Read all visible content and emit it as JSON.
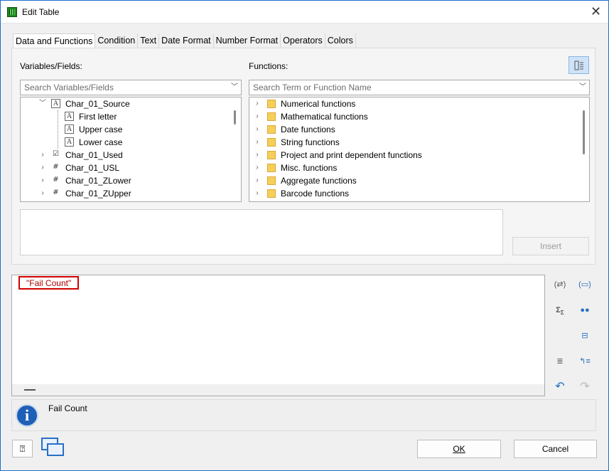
{
  "window": {
    "title": "Edit Table",
    "close_icon": "close-icon",
    "app_icon": "table-app-icon"
  },
  "tabs": [
    "Data and Functions",
    "Condition",
    "Text",
    "Date Format",
    "Number Format",
    "Operators",
    "Colors"
  ],
  "variables": {
    "label": "Variables/Fields:",
    "search_placeholder": "Search Variables/Fields",
    "items": [
      {
        "label": "Char_01_Source",
        "icon": "text-field-icon",
        "expanded": true
      },
      {
        "label": "First letter",
        "icon": "text-field-icon"
      },
      {
        "label": "Upper case",
        "icon": "text-field-icon"
      },
      {
        "label": "Lower case",
        "icon": "text-field-icon"
      },
      {
        "label": "Char_01_Used",
        "icon": "boolean-field-icon"
      },
      {
        "label": "Char_01_USL",
        "icon": "numeric-field-icon"
      },
      {
        "label": "Char_01_ZLower",
        "icon": "numeric-field-icon"
      },
      {
        "label": "Char_01_ZUpper",
        "icon": "numeric-field-icon"
      }
    ]
  },
  "functions": {
    "label": "Functions:",
    "search_placeholder": "Search Term or Function Name",
    "items": [
      "Numerical functions",
      "Mathematical functions",
      "Date functions",
      "String functions",
      "Project and print dependent functions",
      "Misc. functions",
      "Aggregate functions",
      "Barcode functions"
    ]
  },
  "buttons": {
    "insert": "Insert",
    "ok": "OK",
    "cancel": "Cancel"
  },
  "expression": {
    "text": "\"Fail Count\""
  },
  "info": {
    "text": "Fail Count"
  },
  "colors": {
    "accent": "#1c6fd0",
    "highlight_border": "#d00000",
    "expression_text": "#b00000"
  }
}
